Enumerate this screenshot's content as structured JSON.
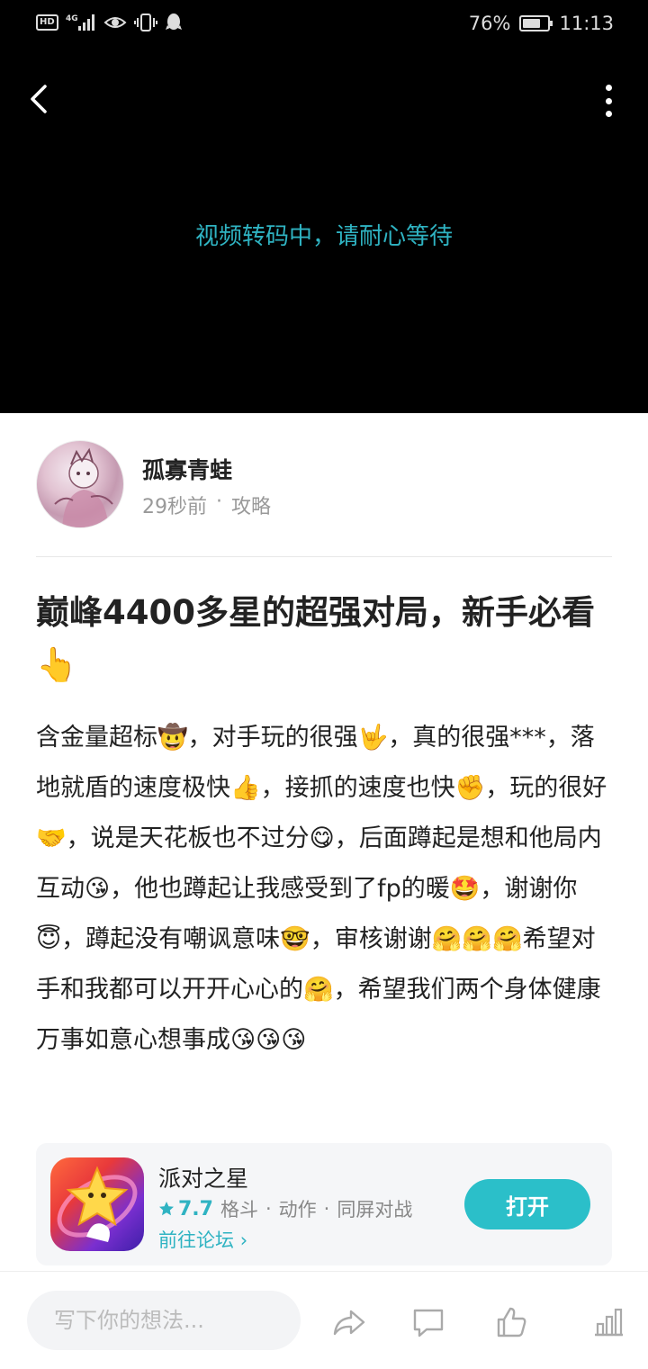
{
  "status_bar": {
    "left_icons": [
      "hd-icon",
      "4g-signal-icon",
      "eye-icon",
      "vibrate-icon",
      "qq-icon"
    ],
    "hd_label": "HD",
    "net_label": "4G",
    "battery_percent": "76%",
    "battery_level": 0.76,
    "time": "11:13"
  },
  "video": {
    "message": "视频转码中，请耐心等待"
  },
  "author": {
    "name": "孤寡青蛙",
    "time": "29秒前",
    "separator": "·",
    "category": "攻略"
  },
  "post": {
    "title": "巅峰4400多星的超强对局，新手必看👆",
    "body": "含金量超标🤠，对手玩的很强🤟，真的很强***，落地就盾的速度极快👍，接抓的速度也快✊，玩的很好🤝，说是天花板也不过分😋，后面蹲起是想和他局内互动😘，他也蹲起让我感受到了fp的暖🤩，谢谢你😇，蹲起没有嘲讽意味🤓，审核谢谢🤗🤗🤗希望对手和我都可以开开心心的🤗，希望我们两个身体健康万事如意心想事成😘😘😘"
  },
  "game_card": {
    "name": "派对之星",
    "rating": "7.7",
    "tags": [
      "格斗",
      "动作",
      "同屏对战"
    ],
    "tag_separator": "·",
    "forum_link": "前往论坛",
    "open_label": "打开",
    "accent_color": "#2bbfc9"
  },
  "bottom_bar": {
    "comment_placeholder": "写下你的想法..."
  }
}
